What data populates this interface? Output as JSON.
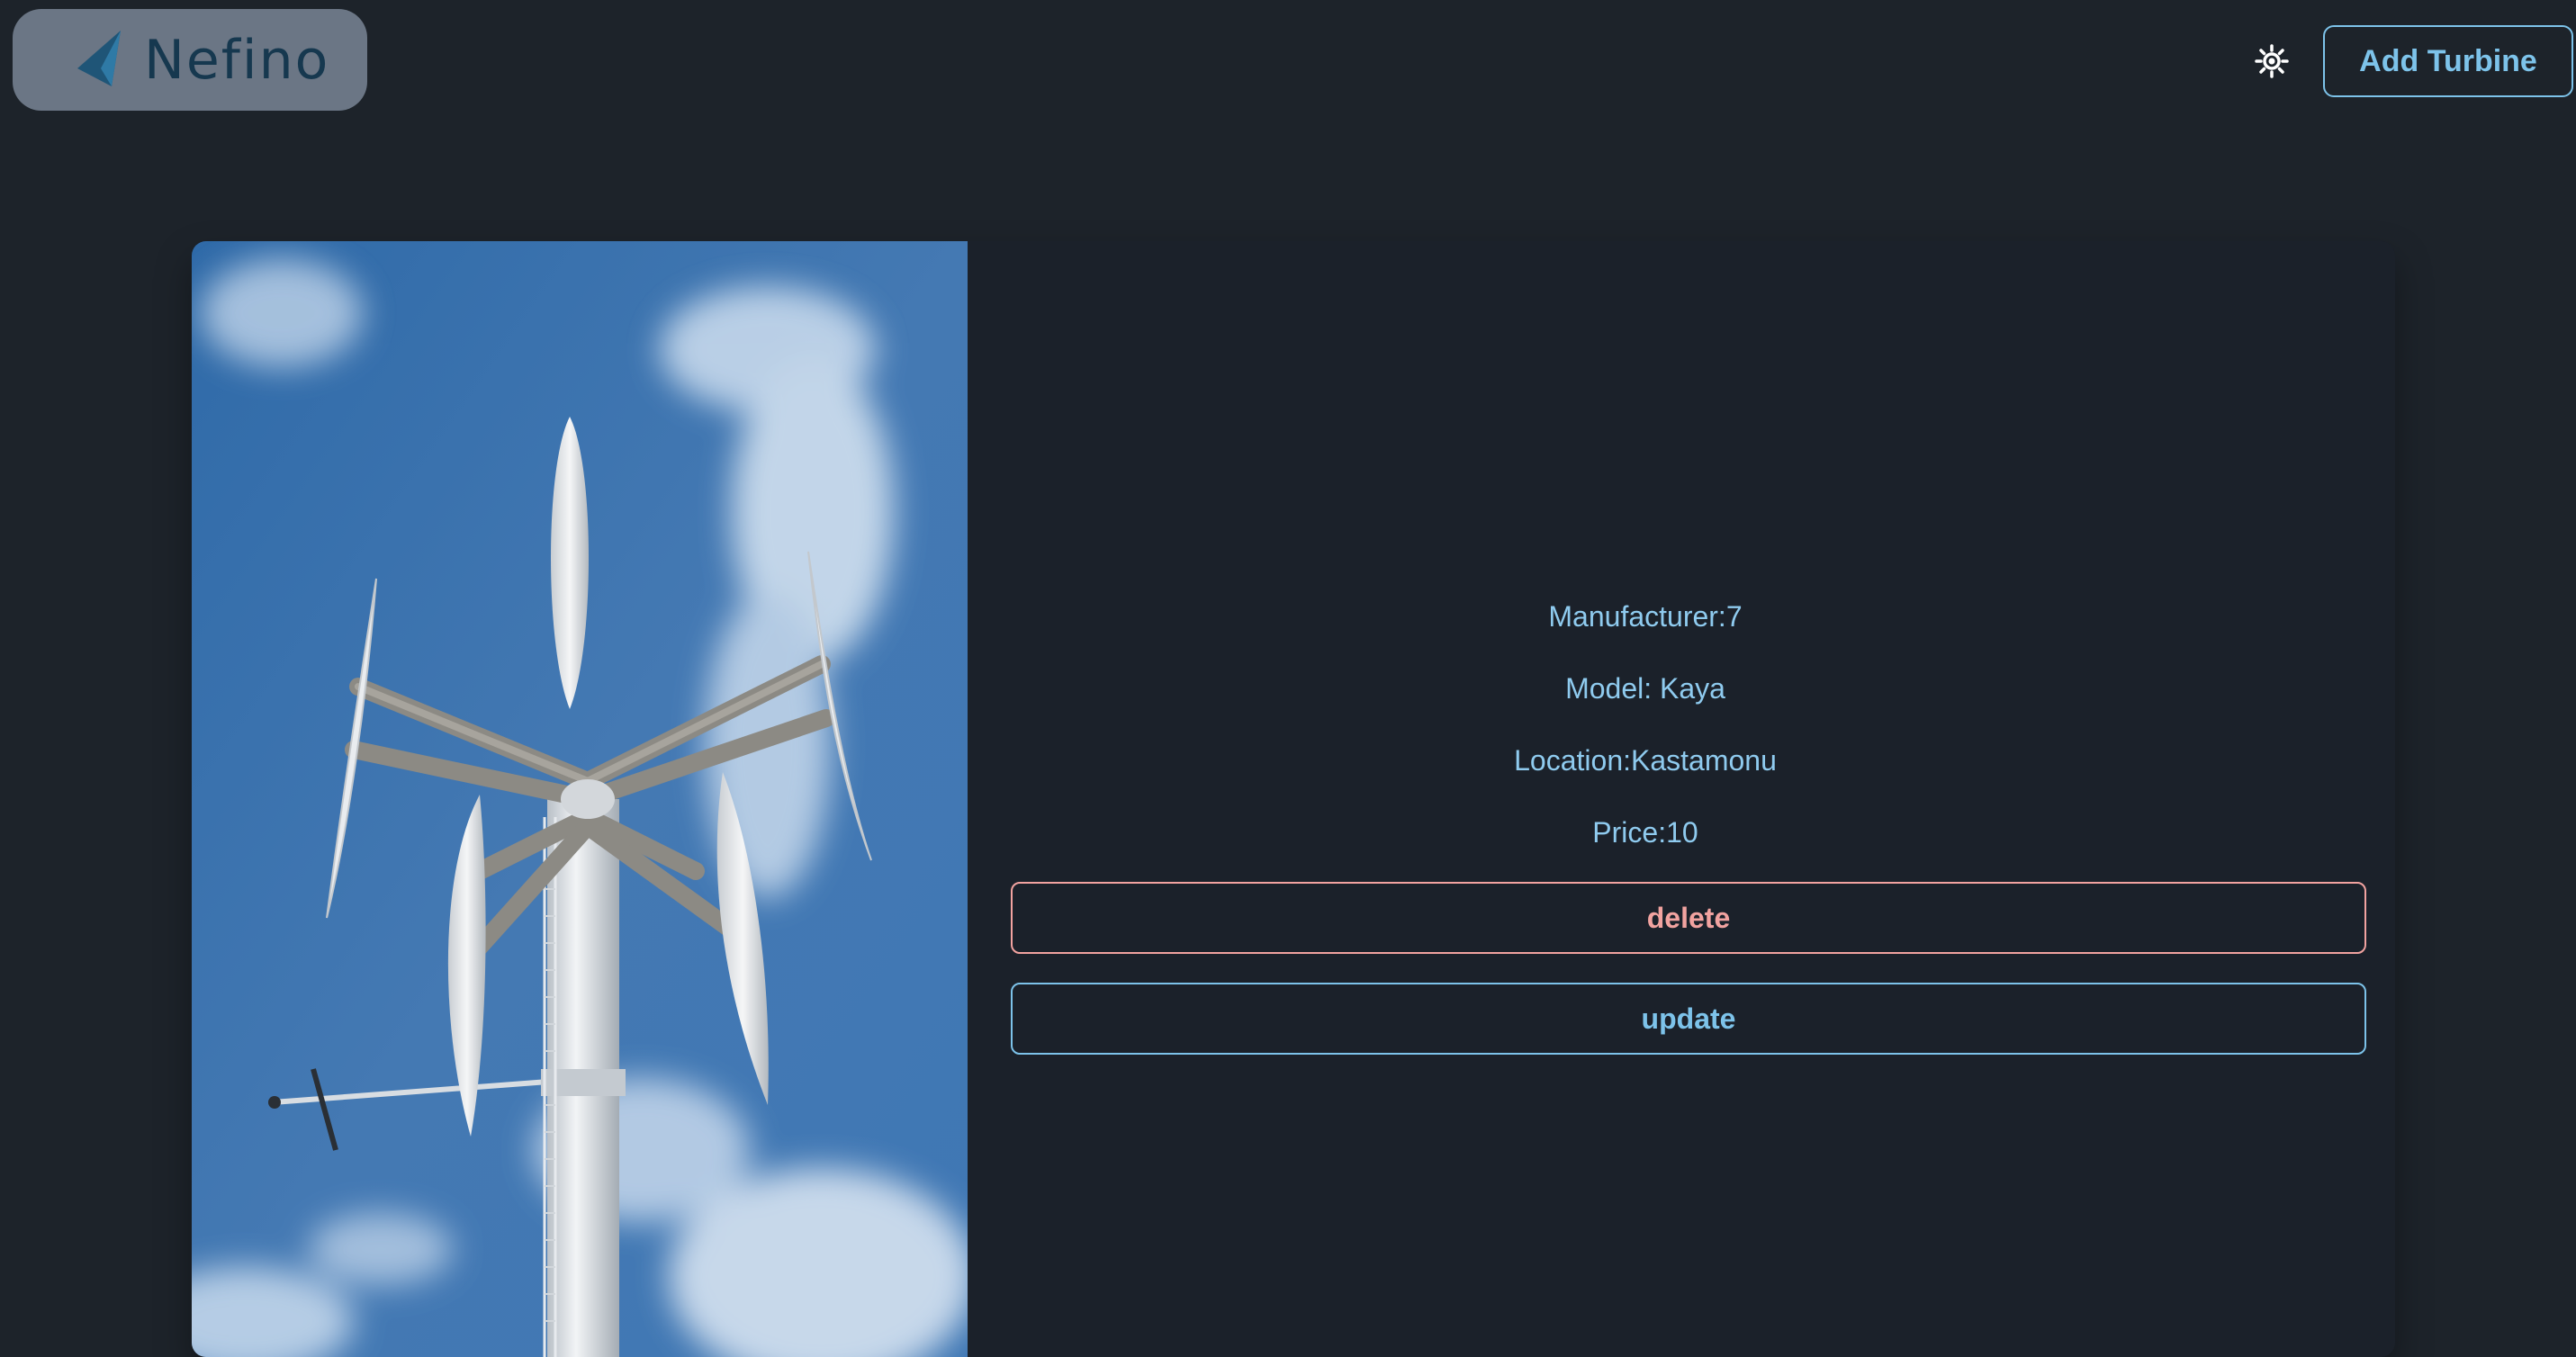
{
  "brand": {
    "name": "Nefino",
    "logo_icon": "nefino-sail-logo-icon"
  },
  "header": {
    "theme_toggle_icon": "sun-icon",
    "add_button_label": "Add Turbine"
  },
  "turbine": {
    "image_alt": "vertical axis wind turbine",
    "manufacturer": "Manufacturer:7",
    "model": "Model: Kaya",
    "location": "Location:Kastamonu",
    "price": "Price:10"
  },
  "actions": {
    "delete_label": "delete",
    "update_label": "update"
  },
  "colors": {
    "background": "#1d232a",
    "accent": "#7dc3ea",
    "danger": "#f2a3a0"
  }
}
